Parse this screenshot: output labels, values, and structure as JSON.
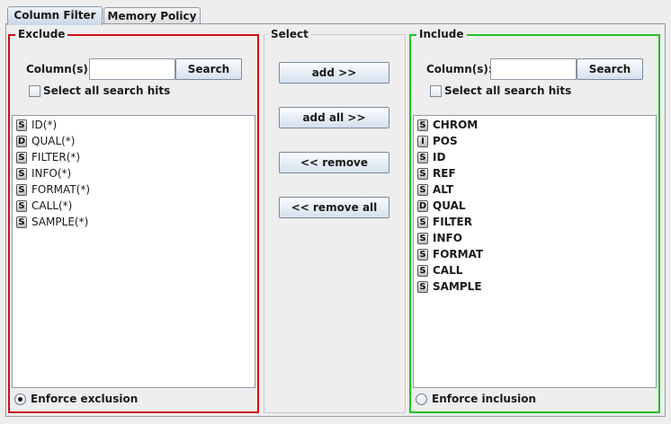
{
  "tabs": [
    {
      "label": "Column Filter",
      "active": true
    },
    {
      "label": "Memory Policy",
      "active": false
    }
  ],
  "exclude": {
    "title": "Exclude",
    "border_color": "#d01010",
    "search_label": "Column(s):",
    "search_value": "",
    "search_button": "Search",
    "select_all_label": "Select all search hits",
    "select_all_checked": false,
    "items": [
      {
        "type": "S",
        "name": "ID(*)"
      },
      {
        "type": "D",
        "name": "QUAL(*)"
      },
      {
        "type": "S",
        "name": "FILTER(*)"
      },
      {
        "type": "S",
        "name": "INFO(*)"
      },
      {
        "type": "S",
        "name": "FORMAT(*)"
      },
      {
        "type": "S",
        "name": "CALL(*)"
      },
      {
        "type": "S",
        "name": "SAMPLE(*)"
      }
    ],
    "enforce_label": "Enforce exclusion",
    "enforce_selected": true
  },
  "select": {
    "title": "Select",
    "add_label": "add >>",
    "add_all_label": "add all >>",
    "remove_label": "<< remove",
    "remove_all_label": "<< remove all"
  },
  "include": {
    "title": "Include",
    "border_color": "#20c020",
    "search_label": "Column(s):",
    "search_value": "",
    "search_button": "Search",
    "select_all_label": "Select all search hits",
    "select_all_checked": false,
    "items": [
      {
        "type": "S",
        "name": "CHROM"
      },
      {
        "type": "I",
        "name": "POS"
      },
      {
        "type": "S",
        "name": "ID"
      },
      {
        "type": "S",
        "name": "REF"
      },
      {
        "type": "S",
        "name": "ALT"
      },
      {
        "type": "D",
        "name": "QUAL"
      },
      {
        "type": "S",
        "name": "FILTER"
      },
      {
        "type": "S",
        "name": "INFO"
      },
      {
        "type": "S",
        "name": "FORMAT"
      },
      {
        "type": "S",
        "name": "CALL"
      },
      {
        "type": "S",
        "name": "SAMPLE"
      }
    ],
    "enforce_label": "Enforce inclusion",
    "enforce_selected": false
  }
}
